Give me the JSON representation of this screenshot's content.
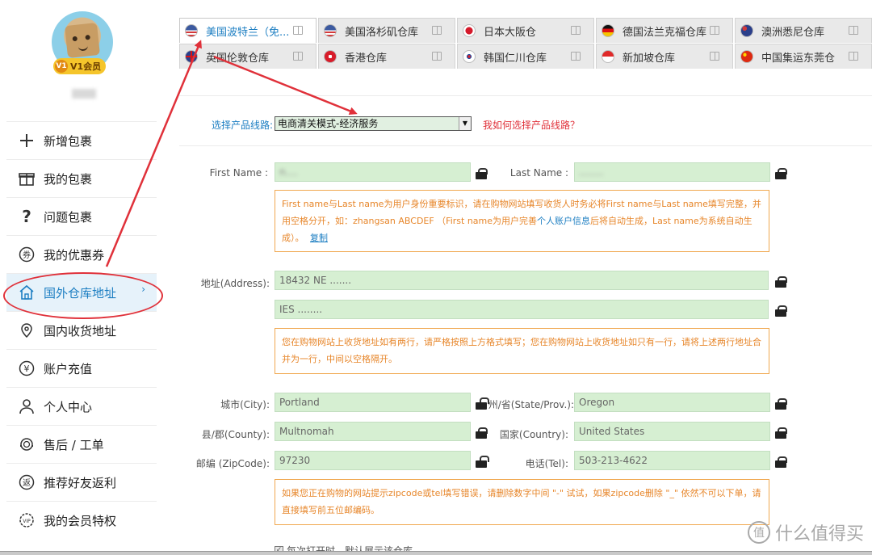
{
  "sidebar": {
    "vip_icon_text": "V1",
    "vip_label": "V1会员",
    "items": [
      {
        "label": "新增包裹",
        "icon": "plus-icon"
      },
      {
        "label": "我的包裹",
        "icon": "gift-icon"
      },
      {
        "label": "问题包裹",
        "icon": "question-icon"
      },
      {
        "label": "我的优惠券",
        "icon": "coupon-icon"
      },
      {
        "label": "国外仓库地址",
        "icon": "house-icon"
      },
      {
        "label": "国内收货地址",
        "icon": "location-pin-icon"
      },
      {
        "label": "账户充值",
        "icon": "yen-icon"
      },
      {
        "label": "个人中心",
        "icon": "user-icon"
      },
      {
        "label": "售后 / 工单",
        "icon": "headset-icon"
      },
      {
        "label": "推荐好友返利",
        "icon": "rebate-icon"
      },
      {
        "label": "我的会员特权",
        "icon": "vip-icon"
      }
    ],
    "active_chevron": "›"
  },
  "tabs": [
    [
      {
        "label": "美国波特兰（免...",
        "flag": "us",
        "active": true
      },
      {
        "label": "美国洛杉矶仓库",
        "flag": "us"
      },
      {
        "label": "日本大阪仓",
        "flag": "jp"
      },
      {
        "label": "德国法兰克福仓库",
        "flag": "de"
      },
      {
        "label": "澳洲悉尼仓库",
        "flag": "au"
      }
    ],
    [
      {
        "label": "英国伦敦仓库",
        "flag": "uk"
      },
      {
        "label": "香港仓库",
        "flag": "hk"
      },
      {
        "label": "韩国仁川仓库",
        "flag": "kr"
      },
      {
        "label": "新加坡仓库",
        "flag": "sg"
      },
      {
        "label": "中国集运东莞仓",
        "flag": "cn"
      }
    ]
  ],
  "route": {
    "label": "选择产品线路:",
    "selected": "电商清关模式-经济服务",
    "help": "我如何选择产品线路？"
  },
  "form": {
    "first_name_label": "First Name :",
    "first_name_value": "n....",
    "last_name_label": "Last Name :",
    "last_name_value": "........",
    "name_note_part1": "First name与Last name为用户身份重要标识，请在购物网站填写收货人时务必将First name与Last name填写完整，并用空格分开，如：zhangsan ABCDEF （First name为用户完善",
    "name_note_link": "个人账户信息",
    "name_note_part2": "后将自动生成，Last name为系统自动生成）。",
    "name_note_copy": "复制",
    "address_label": "地址(Address):",
    "address1_value": "18432 NE .......",
    "address2_value": "IES ........",
    "address_note": "您在购物网站上收货地址如有两行，请严格按照上方格式填写；您在购物网站上收货地址如只有一行，请将上述两行地址合并为一行，中间以空格隔开。",
    "city_label": "城市(City):",
    "city_value": "Portland",
    "state_label": "州/省(State/Prov.):",
    "state_value": "Oregon",
    "county_label": "县/郡(County):",
    "county_value": "Multnomah",
    "country_label": "国家(Country):",
    "country_value": "United States",
    "zip_label": "邮编 (ZipCode):",
    "zip_value": "97230",
    "tel_label": "电话(Tel):",
    "tel_value": "503-213-4622",
    "zip_note": "如果您正在购物的网站提示zipcode或tel填写错误，请删除数字中间 \"-\" 试试，如果zipcode删除 \"_\" 依然不可以下单，请直接填写前五位邮编码。",
    "checkbox_label": "每次打开时，默认展示该仓库",
    "checkbox_mark": "✓"
  },
  "watermark": {
    "logo": "值",
    "text": "什么值得买"
  },
  "colors": {
    "accent": "#1c7ec2",
    "annotation": "#e0313a",
    "field_bg": "#d6efd2",
    "note": "#e7862a"
  }
}
